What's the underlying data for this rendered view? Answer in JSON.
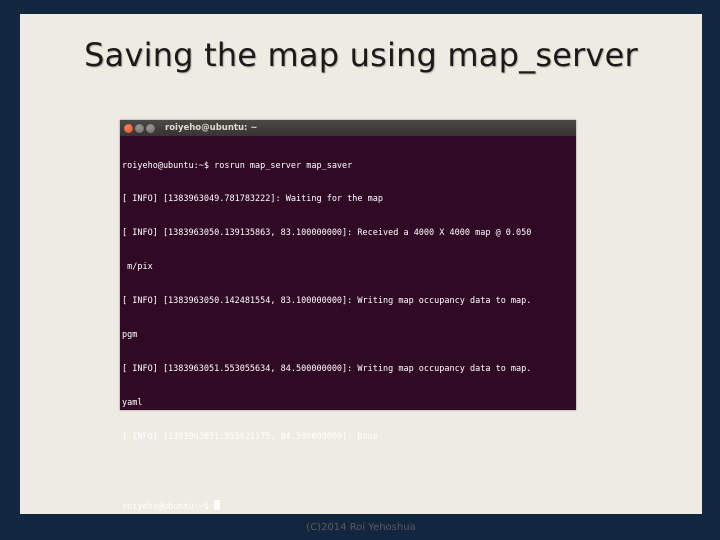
{
  "slide": {
    "title": "Saving the map using map_server",
    "footer": "(C)2014 Roi Yehoshua"
  },
  "terminal": {
    "window_title": "roiyeho@ubuntu: ~",
    "lines": [
      "roiyeho@ubuntu:~$ rosrun map_server map_saver",
      "[ INFO] [1383963049.781783222]: Waiting for the map",
      "[ INFO] [1383963050.139135863, 83.100000000]: Received a 4000 X 4000 map @ 0.050",
      " m/pix",
      "[ INFO] [1383963050.142481554, 83.100000000]: Writing map occupancy data to map.",
      "pgm",
      "[ INFO] [1383963051.553055634, 84.500000000]: Writing map occupancy data to map.",
      "yaml",
      "[ INFO] [1383963051.555821175, 84.500000000]: Done",
      "",
      "roiyeho@ubuntu:~$ "
    ]
  },
  "colors": {
    "frame": "#13263f",
    "slide_bg": "#eeebe2",
    "terminal_bg": "#300a24",
    "terminal_text": "#ffffff"
  }
}
